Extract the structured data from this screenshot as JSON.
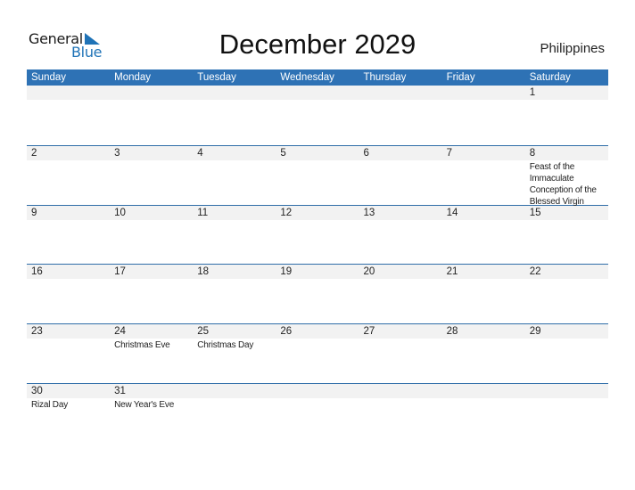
{
  "logo": {
    "line1": "General",
    "line2": "Blue"
  },
  "title": "December 2029",
  "country": "Philippines",
  "colors": {
    "header_bg": "#2e72b5",
    "date_band": "#f2f2f2",
    "logo_blue": "#1f73b7",
    "row_border": "#2f6da8"
  },
  "weekdays": [
    "Sunday",
    "Monday",
    "Tuesday",
    "Wednesday",
    "Thursday",
    "Friday",
    "Saturday"
  ],
  "weeks": [
    [
      {
        "day": "",
        "event": ""
      },
      {
        "day": "",
        "event": ""
      },
      {
        "day": "",
        "event": ""
      },
      {
        "day": "",
        "event": ""
      },
      {
        "day": "",
        "event": ""
      },
      {
        "day": "",
        "event": ""
      },
      {
        "day": "1",
        "event": ""
      }
    ],
    [
      {
        "day": "2",
        "event": ""
      },
      {
        "day": "3",
        "event": ""
      },
      {
        "day": "4",
        "event": ""
      },
      {
        "day": "5",
        "event": ""
      },
      {
        "day": "6",
        "event": ""
      },
      {
        "day": "7",
        "event": ""
      },
      {
        "day": "8",
        "event": "Feast of the Immaculate Conception of the Blessed Virgin"
      }
    ],
    [
      {
        "day": "9",
        "event": ""
      },
      {
        "day": "10",
        "event": ""
      },
      {
        "day": "11",
        "event": ""
      },
      {
        "day": "12",
        "event": ""
      },
      {
        "day": "13",
        "event": ""
      },
      {
        "day": "14",
        "event": ""
      },
      {
        "day": "15",
        "event": ""
      }
    ],
    [
      {
        "day": "16",
        "event": ""
      },
      {
        "day": "17",
        "event": ""
      },
      {
        "day": "18",
        "event": ""
      },
      {
        "day": "19",
        "event": ""
      },
      {
        "day": "20",
        "event": ""
      },
      {
        "day": "21",
        "event": ""
      },
      {
        "day": "22",
        "event": ""
      }
    ],
    [
      {
        "day": "23",
        "event": ""
      },
      {
        "day": "24",
        "event": "Christmas Eve"
      },
      {
        "day": "25",
        "event": "Christmas Day"
      },
      {
        "day": "26",
        "event": ""
      },
      {
        "day": "27",
        "event": ""
      },
      {
        "day": "28",
        "event": ""
      },
      {
        "day": "29",
        "event": ""
      }
    ],
    [
      {
        "day": "30",
        "event": "Rizal Day"
      },
      {
        "day": "31",
        "event": "New Year's Eve"
      },
      {
        "day": "",
        "event": ""
      },
      {
        "day": "",
        "event": ""
      },
      {
        "day": "",
        "event": ""
      },
      {
        "day": "",
        "event": ""
      },
      {
        "day": "",
        "event": ""
      }
    ]
  ]
}
